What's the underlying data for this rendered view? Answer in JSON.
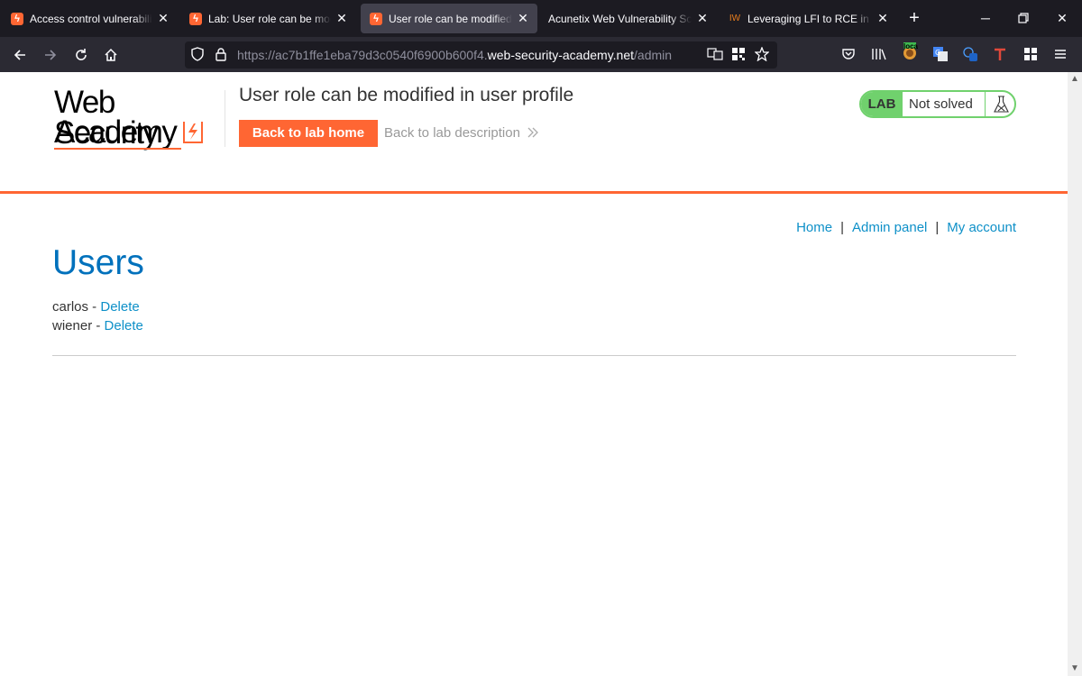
{
  "browser": {
    "tabs": [
      {
        "label": "Access control vulnerabilities",
        "favicon": "bolt",
        "active": false
      },
      {
        "label": "Lab: User role can be modified",
        "favicon": "bolt",
        "active": false
      },
      {
        "label": "User role can be modified in user profile",
        "favicon": "bolt",
        "active": true
      },
      {
        "label": "Acunetix Web Vulnerability Scanner",
        "favicon": "none",
        "active": false
      },
      {
        "label": "Leveraging LFI to RCE in a website",
        "favicon": "IW",
        "active": false
      }
    ],
    "url": {
      "prefix": "https://ac7b1ffe1eba79d3c0540f6900b600f4.",
      "host": "web-security-academy.net",
      "path": "/admin"
    },
    "extension_badge": "loca"
  },
  "header": {
    "logo_line1": "Web Security",
    "logo_line2": "Academy",
    "lab_title": "User role can be modified in user profile",
    "back_to_lab_home": "Back to lab home",
    "back_to_lab_description": "Back to lab description",
    "status_label": "LAB",
    "status_text": "Not solved"
  },
  "nav": {
    "home": "Home",
    "admin_panel": "Admin panel",
    "my_account": "My account",
    "separator": "|"
  },
  "main": {
    "heading": "Users",
    "users": [
      {
        "name": "carlos",
        "separator": " - ",
        "action": "Delete"
      },
      {
        "name": "wiener",
        "separator": " - ",
        "action": "Delete"
      }
    ]
  },
  "colors": {
    "brand_orange": "#ff6633",
    "link_blue": "#0e90c8",
    "heading_blue": "#0071bc",
    "status_green": "#70d16d"
  }
}
